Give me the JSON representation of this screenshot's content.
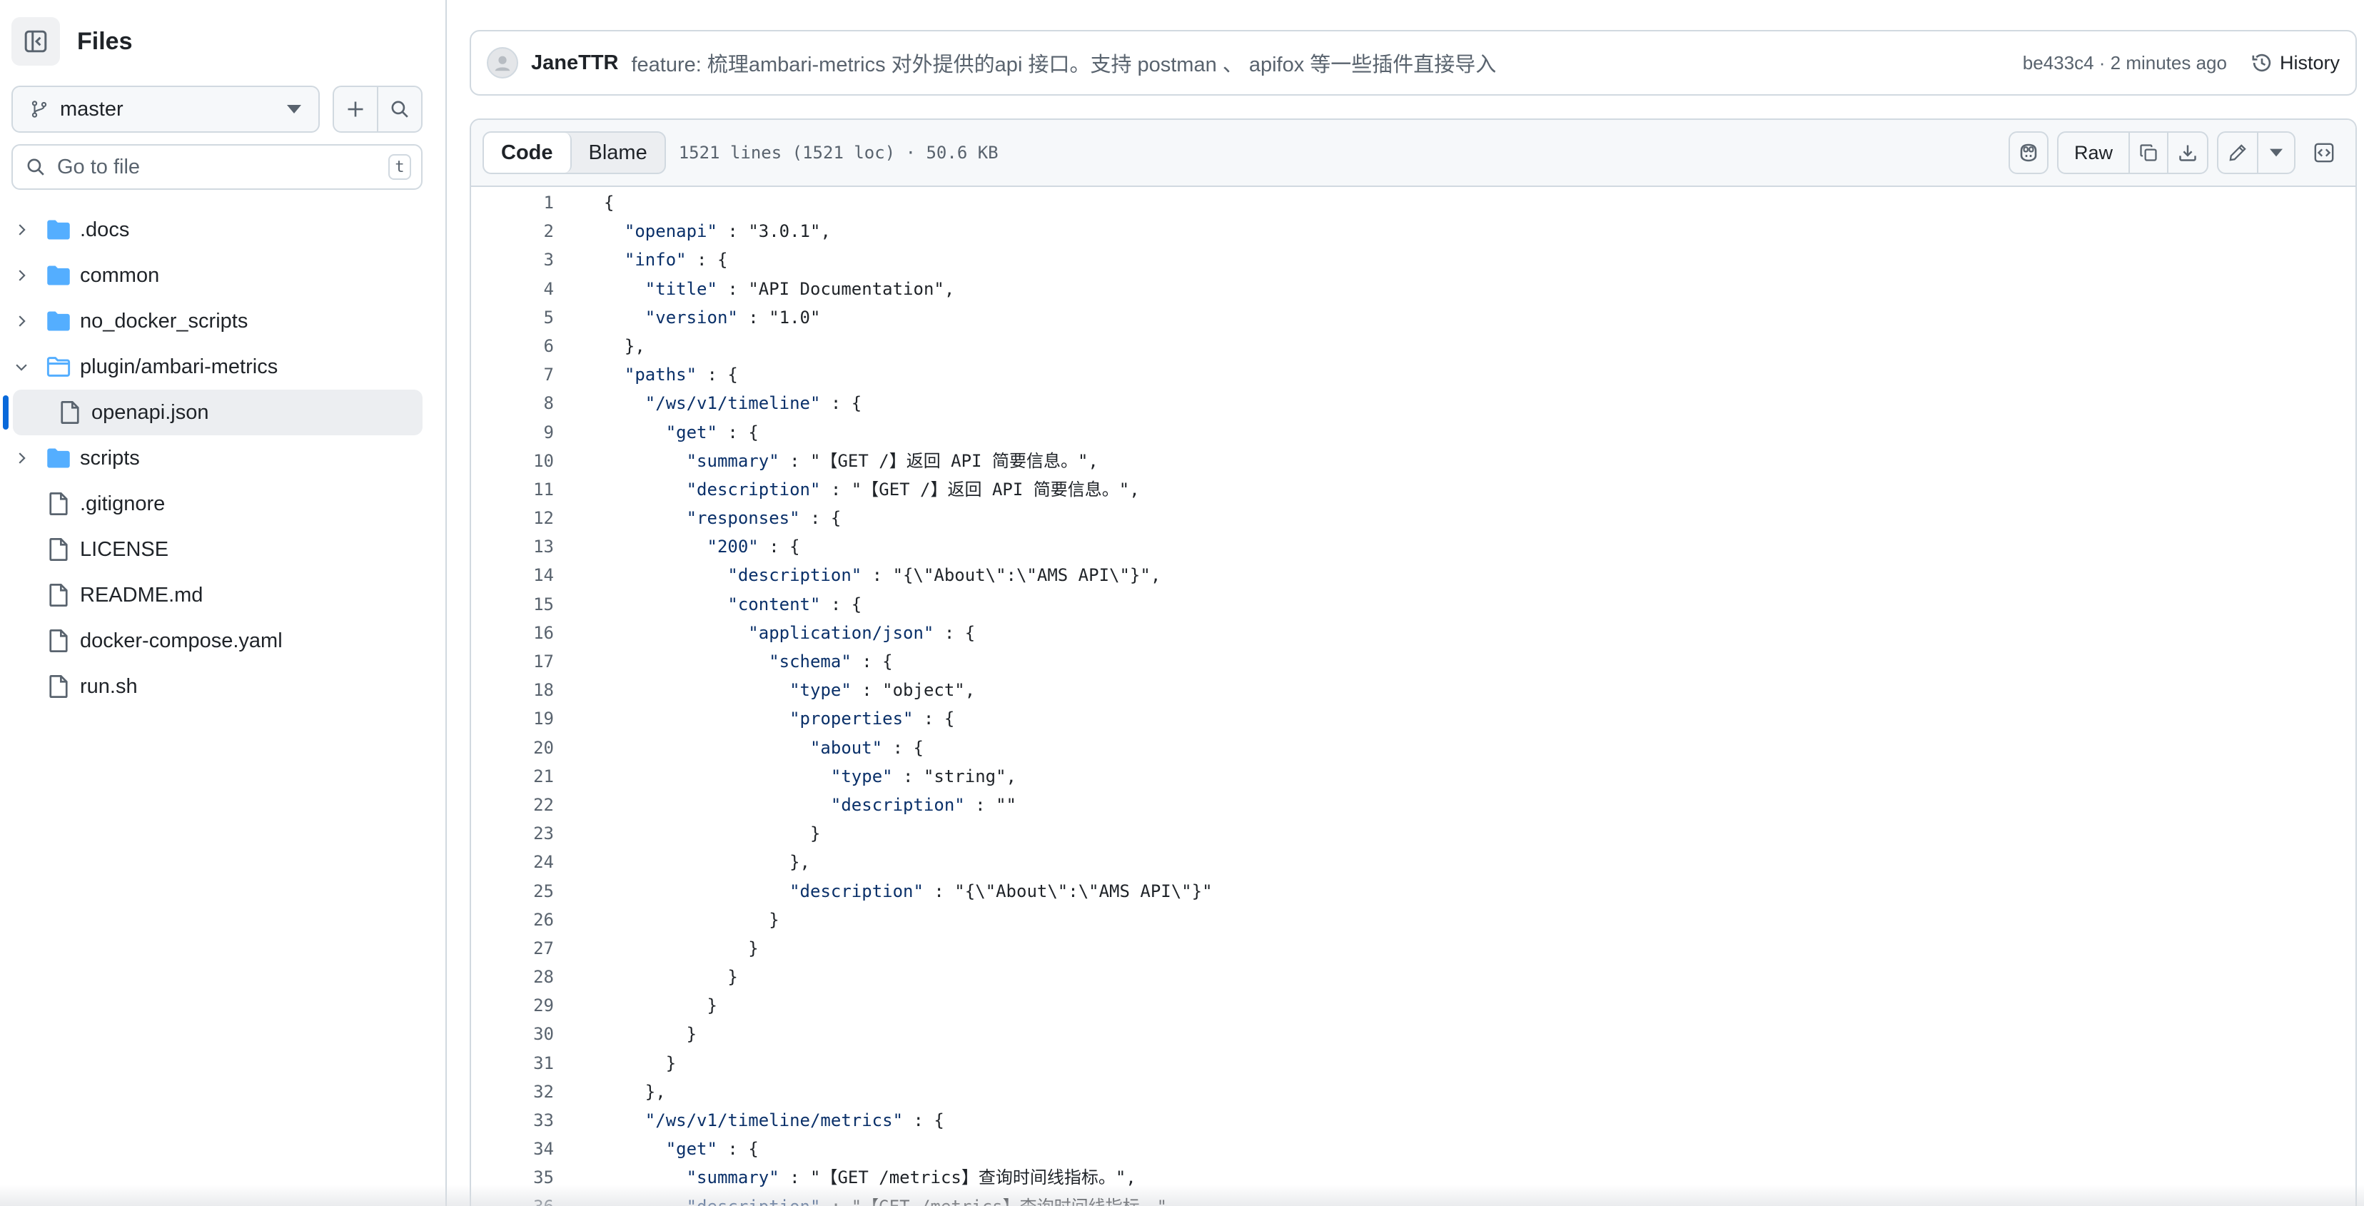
{
  "sidebar": {
    "title": "Files",
    "branch": "master",
    "goto_placeholder": "Go to file",
    "goto_shortcut": "t",
    "tree": [
      {
        "name": ".docs",
        "type": "folder",
        "expanded": false
      },
      {
        "name": "common",
        "type": "folder",
        "expanded": false
      },
      {
        "name": "no_docker_scripts",
        "type": "folder",
        "expanded": false
      },
      {
        "name": "plugin/ambari-metrics",
        "type": "folder",
        "expanded": true
      },
      {
        "name": "openapi.json",
        "type": "file",
        "selected": true,
        "child": true
      },
      {
        "name": "scripts",
        "type": "folder",
        "expanded": false
      },
      {
        "name": ".gitignore",
        "type": "file"
      },
      {
        "name": "LICENSE",
        "type": "file"
      },
      {
        "name": "README.md",
        "type": "file"
      },
      {
        "name": "docker-compose.yaml",
        "type": "file"
      },
      {
        "name": "run.sh",
        "type": "file"
      }
    ]
  },
  "commit": {
    "author": "JaneTTR",
    "message": "feature: 梳理ambari-metrics 对外提供的api 接口。支持 postman 、 apifox 等一些插件直接导入",
    "meta": "be433c4 · 2 minutes ago",
    "history_label": "History"
  },
  "file": {
    "tab_code": "Code",
    "tab_blame": "Blame",
    "info": "1521 lines (1521 loc) · 50.6 KB",
    "raw_label": "Raw",
    "lines": [
      "{",
      "  \"openapi\" : \"3.0.1\",",
      "  \"info\" : {",
      "    \"title\" : \"API Documentation\",",
      "    \"version\" : \"1.0\"",
      "  },",
      "  \"paths\" : {",
      "    \"/ws/v1/timeline\" : {",
      "      \"get\" : {",
      "        \"summary\" : \"【GET /】返回 API 简要信息。\",",
      "        \"description\" : \"【GET /】返回 API 简要信息。\",",
      "        \"responses\" : {",
      "          \"200\" : {",
      "            \"description\" : \"{\\\"About\\\":\\\"AMS API\\\"}\",",
      "            \"content\" : {",
      "              \"application/json\" : {",
      "                \"schema\" : {",
      "                  \"type\" : \"object\",",
      "                  \"properties\" : {",
      "                    \"about\" : {",
      "                      \"type\" : \"string\",",
      "                      \"description\" : \"\"",
      "                    }",
      "                  },",
      "                  \"description\" : \"{\\\"About\\\":\\\"AMS API\\\"}\"",
      "                }",
      "              }",
      "            }",
      "          }",
      "        }",
      "      }",
      "    },",
      "    \"/ws/v1/timeline/metrics\" : {",
      "      \"get\" : {",
      "        \"summary\" : \"【GET /metrics】查询时间线指标。\",",
      "        \"description\" : \"【GET /metrics】查询时间线指标。\","
    ]
  }
}
